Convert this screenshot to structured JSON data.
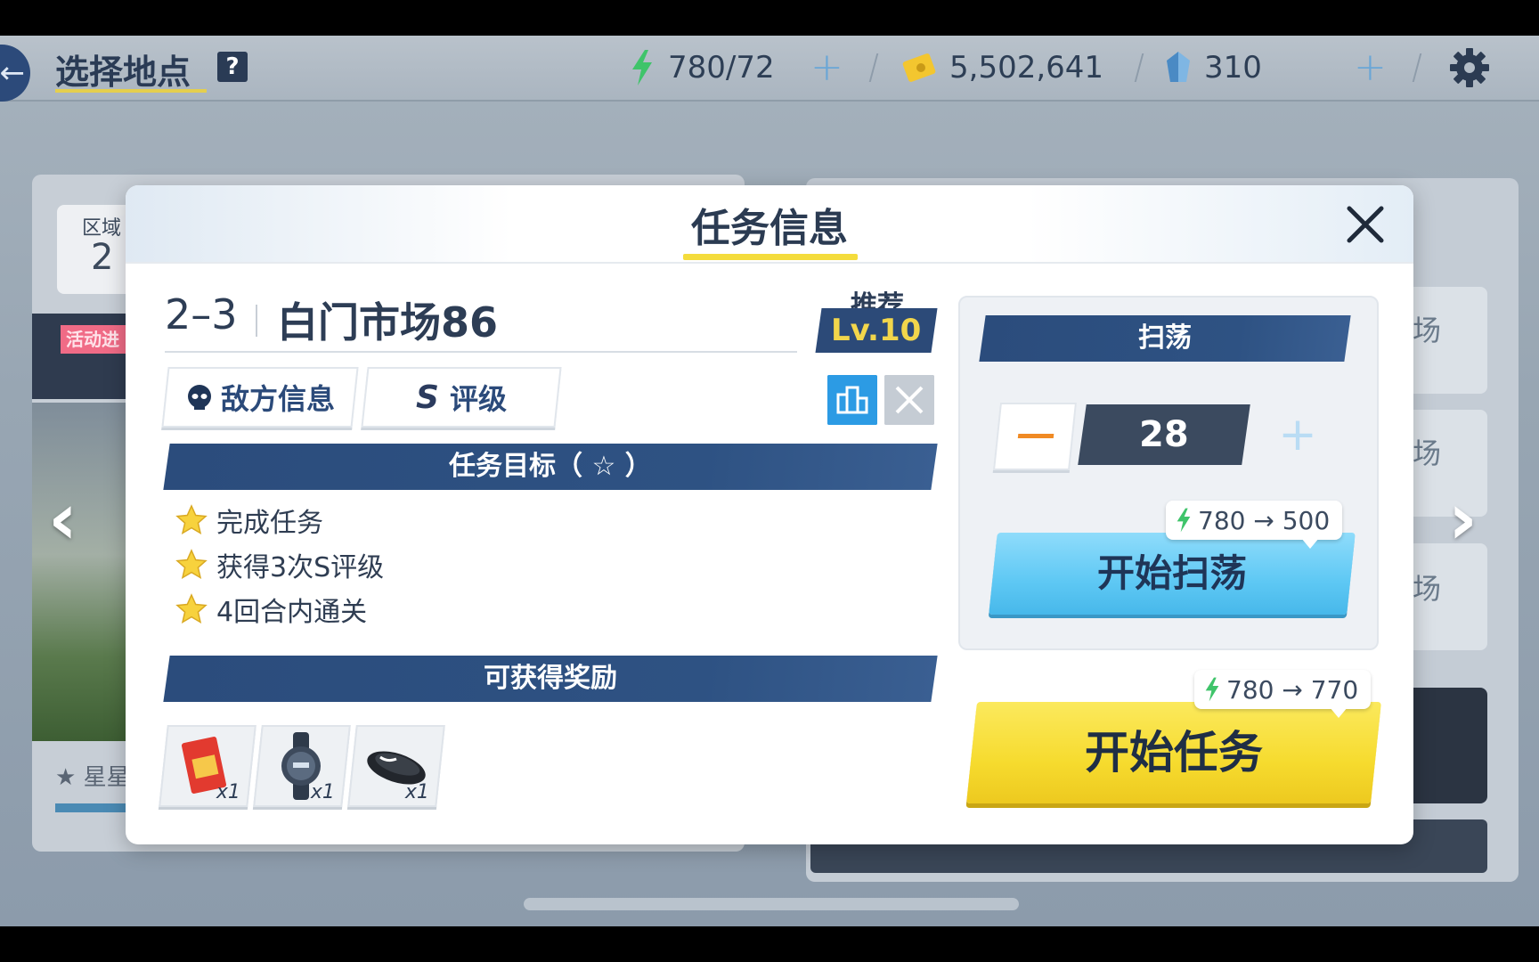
{
  "topbar": {
    "title": "选择地点",
    "help": "?",
    "stamina": "780/72",
    "credits": "5,502,641",
    "gems": "310",
    "plus": "+"
  },
  "background": {
    "area_label": "区域",
    "area_number": "2",
    "event_tag": "活动进",
    "star_label": "星星",
    "card_labels": [
      "场",
      "场",
      "场"
    ]
  },
  "nav": {
    "prev": "‹",
    "next": "›"
  },
  "modal": {
    "title": "任务信息",
    "stage_code": "2–3",
    "stage_name": "白门市场86",
    "recommend_label": "推荐",
    "recommend_level": "Lv.10",
    "enemy_info": "敌方信息",
    "rating_letter": "S",
    "rating": "评级",
    "goal_header": "任务目标（ ☆ ）",
    "goals": [
      "完成任务",
      "获得3次S评级",
      "4回合内通关"
    ],
    "reward_header": "可获得奖励",
    "rewards": [
      {
        "icon": "red-envelope-icon",
        "qty": "x1"
      },
      {
        "icon": "watch-icon",
        "qty": "x1"
      },
      {
        "icon": "wristband-icon",
        "qty": "x1"
      }
    ],
    "sweep": {
      "header": "扫荡",
      "minus": "–",
      "count": "28",
      "plus": "+",
      "cost": "780 → 500",
      "button": "开始扫荡"
    },
    "mission": {
      "cost": "780 → 770",
      "button": "开始任务"
    }
  },
  "colors": {
    "accent_yellow": "#f4dc3c",
    "navy": "#2b4c7c",
    "sweep_blue": "#5ec8f4",
    "stamina_green": "#3fc46a"
  }
}
